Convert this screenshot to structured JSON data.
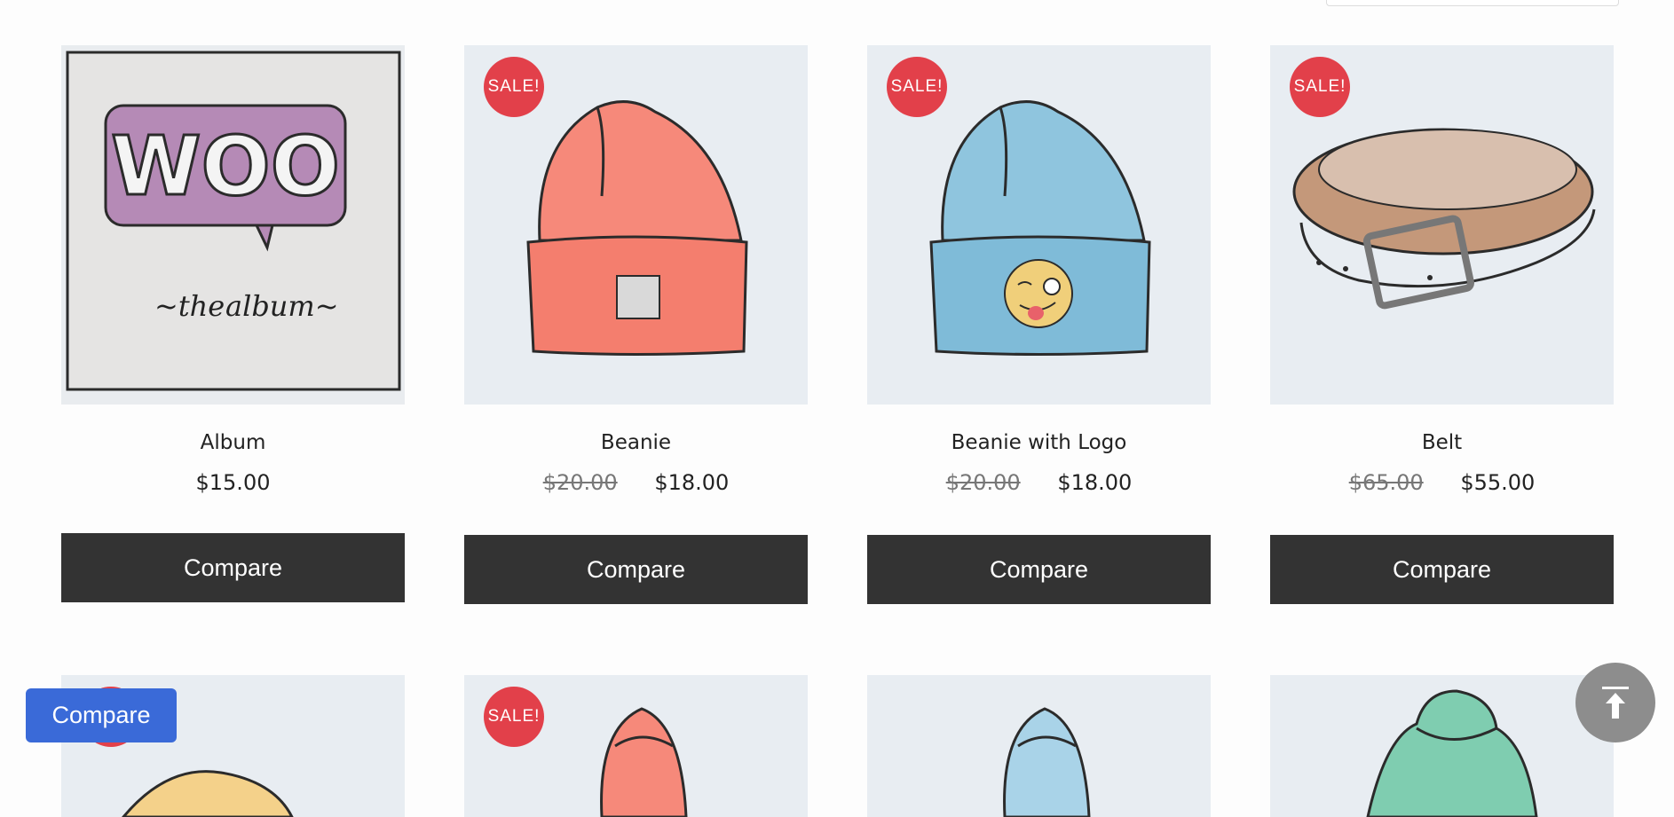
{
  "products": [
    {
      "name": "Album",
      "sale": false,
      "old_price": "",
      "price": "$15.00",
      "button": "Compare",
      "image": "woo-album-illustration"
    },
    {
      "name": "Beanie",
      "sale": true,
      "sale_label": "SALE!",
      "old_price": "$20.00",
      "price": "$18.00",
      "button": "Compare",
      "image": "orange-beanie-illustration"
    },
    {
      "name": "Beanie with Logo",
      "sale": true,
      "sale_label": "SALE!",
      "old_price": "$20.00",
      "price": "$18.00",
      "button": "Compare",
      "image": "blue-beanie-with-emoji-illustration"
    },
    {
      "name": "Belt",
      "sale": true,
      "sale_label": "SALE!",
      "old_price": "$65.00",
      "price": "$55.00",
      "button": "Compare",
      "image": "leather-belt-illustration"
    }
  ],
  "row2": [
    {
      "sale": true,
      "sale_label": "",
      "image": "cap-illustration"
    },
    {
      "sale": true,
      "sale_label": "SALE!",
      "image": "orange-hoodie-illustration"
    },
    {
      "sale": false,
      "image": "blue-hoodie-illustration"
    },
    {
      "sale": false,
      "image": "green-hoodie-illustration"
    }
  ],
  "floating": {
    "compare_label": "Compare",
    "scroll_top_icon": "arrow-up-to-line-icon"
  },
  "colors": {
    "sale": "#e2404a",
    "button": "#333333",
    "compare_fab": "#3a6ad8",
    "thumb_bg": "#e8edf2"
  }
}
